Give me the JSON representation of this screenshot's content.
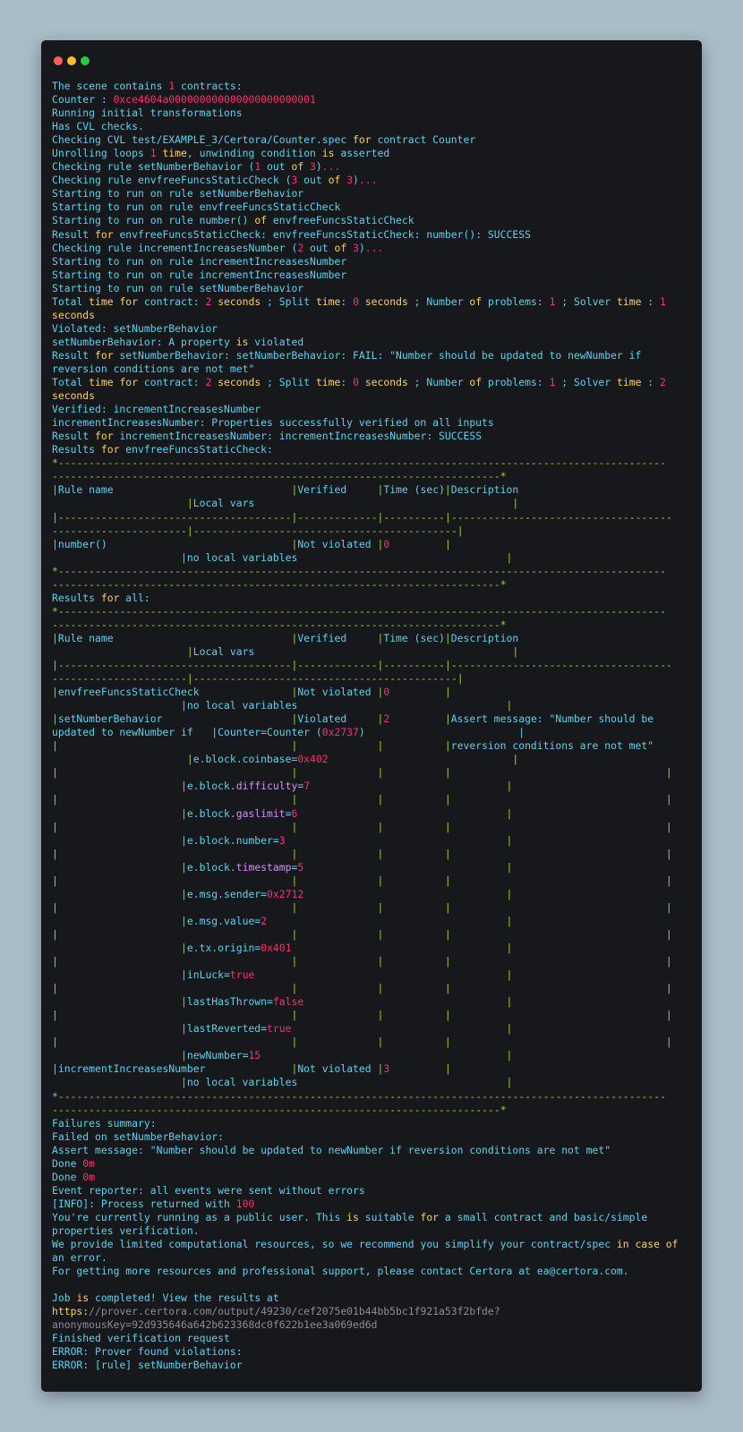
{
  "window": {
    "controls": [
      "close-dot",
      "minimize-dot",
      "maximize-dot"
    ]
  },
  "colors": {
    "background": "#a9bdc7",
    "terminal": "#16181b",
    "cyan": "#5fd1f0",
    "red": "#ff2d6f",
    "yellow": "#ffd25a",
    "green": "#9fcf3a",
    "violet": "#d98cff",
    "gray": "#8a8f95"
  },
  "terminal": {
    "lines": [
      "The scene contains 1 contracts:",
      "Counter : 0xce4604a000000000000000000000001",
      "Running initial transformations",
      "Has CVL checks.",
      "Checking CVL test/EXAMPLE_3/Certora/Counter.spec for contract Counter",
      "Unrolling loops 1 time, unwinding condition is asserted",
      "Checking rule setNumberBehavior (1 out of 3)...",
      "Checking rule envfreeFuncsStaticCheck (3 out of 3)...",
      "Starting to run on rule setNumberBehavior",
      "Starting to run on rule envfreeFuncsStaticCheck",
      "Starting to run on rule number() of envfreeFuncsStaticCheck",
      "Result for envfreeFuncsStaticCheck: envfreeFuncsStaticCheck: number(): SUCCESS",
      "Checking rule incrementIncreasesNumber (2 out of 3)...",
      "Starting to run on rule incrementIncreasesNumber",
      "Starting to run on rule incrementIncreasesNumber",
      "Starting to run on rule setNumberBehavior",
      "Total time for contract: 2 seconds ; Split time: 0 seconds ; Number of problems: 1 ; Solver time : 1",
      "seconds",
      "Violated: setNumberBehavior",
      "setNumberBehavior: A property is violated",
      "Result for setNumberBehavior: setNumberBehavior: FAIL: \"Number should be updated to newNumber if",
      "reversion conditions are not met\"",
      "Total time for contract: 2 seconds ; Split time: 0 seconds ; Number of problems: 1 ; Solver time : 2",
      "seconds",
      "Verified: incrementIncreasesNumber",
      "incrementIncreasesNumber: Properties successfully verified on all inputs",
      "Result for incrementIncreasesNumber: incrementIncreasesNumber: SUCCESS",
      "Results for envfreeFuncsStaticCheck:",
      "*---------------------------------------------------------------------------------------------------",
      "-------------------------------------------------------------------------*",
      "|Rule name                             |Verified     |Time (sec)|Description",
      "                      |Local vars                                          |",
      "|--------------------------------------|-------------|----------|------------------------------------",
      "----------------------|-------------------------------------------|",
      "|number()                              |Not violated |0         |",
      "                     |no local variables                                  |",
      "*---------------------------------------------------------------------------------------------------",
      "-------------------------------------------------------------------------*",
      "Results for all:",
      "*---------------------------------------------------------------------------------------------------",
      "-------------------------------------------------------------------------*",
      "|Rule name                             |Verified     |Time (sec)|Description",
      "                      |Local vars                                          |",
      "|--------------------------------------|-------------|----------|------------------------------------",
      "----------------------|-------------------------------------------|",
      "|envfreeFuncsStaticCheck               |Not violated |0         |",
      "                     |no local variables                                  |",
      "|setNumberBehavior                     |Violated     |2         |Assert message: \"Number should be",
      "updated to newNumber if   |Counter=Counter (0x2737)                         |",
      "|                                      |             |          |reversion conditions are not met\"",
      "                      |e.block.coinbase=0x402                              |",
      "|                                      |             |          |                                   |",
      "                     |e.block.difficulty=7                                |",
      "|                                      |             |          |                                   |",
      "                     |e.block.gaslimit=6                                  |",
      "|                                      |             |          |                                   |",
      "                     |e.block.number=3                                    |",
      "|                                      |             |          |                                   |",
      "                     |e.block.timestamp=5                                 |",
      "|                                      |             |          |                                   |",
      "                     |e.msg.sender=0x2712                                 |",
      "|                                      |             |          |                                   |",
      "                     |e.msg.value=2                                       |",
      "|                                      |             |          |                                   |",
      "                     |e.tx.origin=0x401                                   |",
      "|                                      |             |          |                                   |",
      "                     |inLuck=true                                         |",
      "|                                      |             |          |                                   |",
      "                     |lastHasThrown=false                                 |",
      "|                                      |             |          |                                   |",
      "                     |lastReverted=true                                   |",
      "|                                      |             |          |                                   |",
      "                     |newNumber=15                                        |",
      "|incrementIncreasesNumber              |Not violated |3         |",
      "                     |no local variables                                  |",
      "*---------------------------------------------------------------------------------------------------",
      "-------------------------------------------------------------------------*",
      "Failures summary:",
      "Failed on setNumberBehavior:",
      "Assert message: \"Number should be updated to newNumber if reversion conditions are not met\"",
      "Done 0m",
      "Done 0m",
      "Event reporter: all events were sent without errors",
      "[INFO]: Process returned with 100",
      "You're currently running as a public user. This is suitable for a small contract and basic/simple",
      "properties verification.",
      "We provide limited computational resources, so we recommend you simplify your contract/spec in case of",
      "an error.",
      "For getting more resources and professional support, please contact Certora at ea@certora.com.",
      "",
      "Job is completed! View the results at",
      "https://prover.certora.com/output/49230/cef2075e01b44bb5bc1f921a53f2bfde?",
      "anonymousKey=92d935646a642b623368dc0f622b1ee3a069ed6d",
      "Finished verification request",
      "ERROR: Prover found violations:",
      "ERROR: [rule] setNumberBehavior"
    ]
  }
}
